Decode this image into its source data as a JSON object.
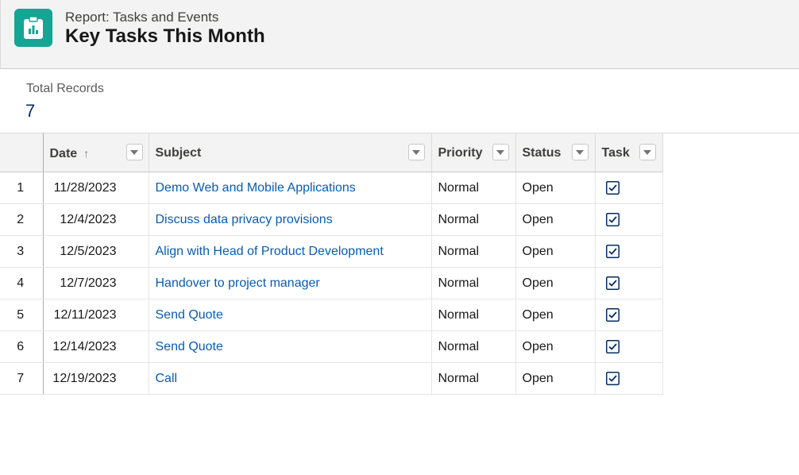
{
  "header": {
    "eyebrow": "Report: Tasks and Events",
    "title": "Key Tasks This Month",
    "icon": "report-icon",
    "icon_color": "#14a594"
  },
  "summary": {
    "label": "Total Records",
    "value": "7"
  },
  "table": {
    "columns": [
      {
        "key": "date",
        "label": "Date",
        "sorted": "ascending"
      },
      {
        "key": "subject",
        "label": "Subject"
      },
      {
        "key": "priority",
        "label": "Priority"
      },
      {
        "key": "status",
        "label": "Status"
      },
      {
        "key": "task",
        "label": "Task"
      }
    ],
    "rows": [
      {
        "num": "1",
        "date": "11/28/2023",
        "subject": "Demo Web and Mobile Applications",
        "priority": "Normal",
        "status": "Open",
        "task": true
      },
      {
        "num": "2",
        "date": "12/4/2023",
        "subject": "Discuss data privacy provisions",
        "priority": "Normal",
        "status": "Open",
        "task": true
      },
      {
        "num": "3",
        "date": "12/5/2023",
        "subject": "Align with Head of Product Development",
        "priority": "Normal",
        "status": "Open",
        "task": true
      },
      {
        "num": "4",
        "date": "12/7/2023",
        "subject": "Handover to project manager",
        "priority": "Normal",
        "status": "Open",
        "task": true
      },
      {
        "num": "5",
        "date": "12/11/2023",
        "subject": "Send Quote",
        "priority": "Normal",
        "status": "Open",
        "task": true
      },
      {
        "num": "6",
        "date": "12/14/2023",
        "subject": "Send Quote",
        "priority": "Normal",
        "status": "Open",
        "task": true
      },
      {
        "num": "7",
        "date": "12/19/2023",
        "subject": "Call",
        "priority": "Normal",
        "status": "Open",
        "task": true
      }
    ]
  },
  "colors": {
    "link": "#0b5cab",
    "header_bg": "#f3f3f3",
    "checkbox": "#032d60"
  }
}
